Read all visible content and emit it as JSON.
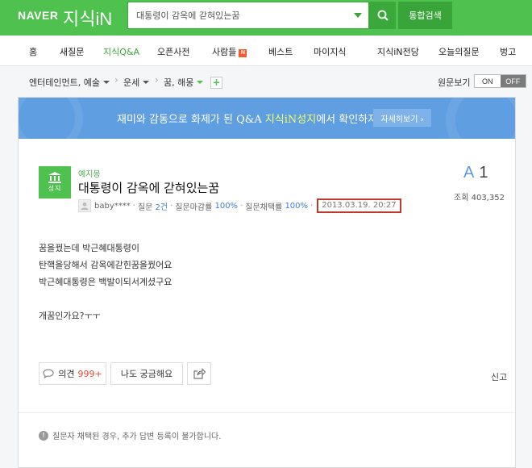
{
  "header": {
    "logo_naver": "NAVER",
    "logo_service": "지식iN",
    "search_value": "대통령이 감옥에 갇혀있는꿈",
    "total_search_label": "통합검색",
    "brand_color": "#4ec14f"
  },
  "nav": {
    "items": [
      {
        "label": "홈"
      },
      {
        "label": "새질문"
      },
      {
        "label": "지식Q&A"
      },
      {
        "label": "오픈사전"
      },
      {
        "label": "사람들"
      },
      {
        "label": "베스트"
      },
      {
        "label": "마이지식"
      },
      {
        "label": "지식iN전당"
      },
      {
        "label": "오늘의질문"
      },
      {
        "label": "벙고"
      }
    ],
    "badge": "N"
  },
  "breadcrumb": {
    "items": [
      "엔터테인먼트, 예술",
      "운세",
      "꿈, 해몽"
    ],
    "add_label": "+"
  },
  "view_toggle": {
    "label": "원문보기",
    "on": "ON",
    "off": "OFF"
  },
  "banner": {
    "text_before": "재미와 감동으로 화제가 된 Q&A ",
    "highlight": "지식iN성지",
    "text_after": "에서 확인하자!",
    "button_label": "자세히보기 ›"
  },
  "question": {
    "badge_label": "성지",
    "category": "예지몽",
    "title": "대통령이 감옥에 갇혀있는꿈",
    "author": "baby****",
    "q_label": "질문",
    "q_count": "2건",
    "close_label": "질문마감률",
    "close_rate": "100%",
    "select_label": "질문채택률",
    "select_rate": "100%",
    "date": "2013.03.19. 20:27",
    "answer_icon": "A",
    "answer_count": "1",
    "views_label": "조회",
    "views": "403,352",
    "body": [
      "꿈을꿨는데 박근혜대통령이",
      "탄핵을당해서 감옥에갇힌꿈을꿨어요",
      "박근혜대통령은 백발이되서계셨구요",
      "",
      "개꿈인가요?ㅜㅜ"
    ]
  },
  "actions": {
    "opinion_label": "의견",
    "opinion_count": "999+",
    "curious_label": "나도 궁금해요",
    "report_label": "신고"
  },
  "notice": {
    "text": "질문자 채택된 경우, 추가 답변 등록이 불가합니다."
  }
}
